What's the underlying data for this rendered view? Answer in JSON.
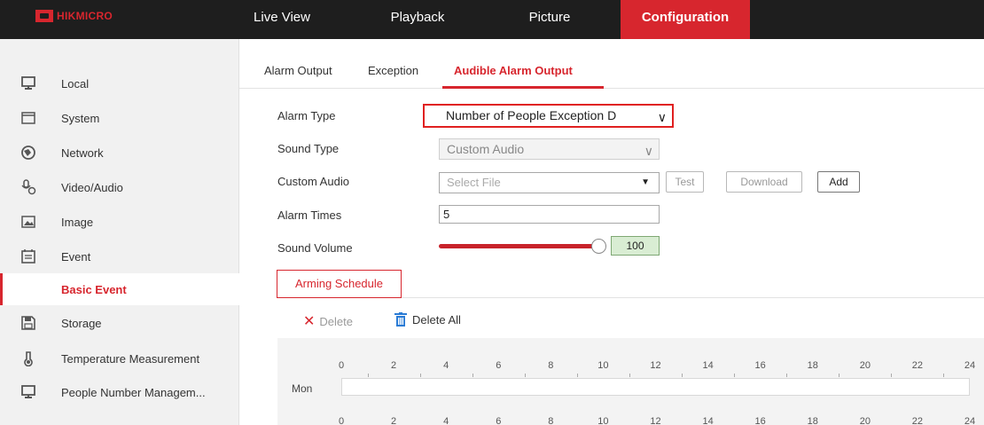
{
  "brand": {
    "name": "HIKMICRO",
    "color": "#d7262e"
  },
  "nav": [
    {
      "label": "Live View"
    },
    {
      "label": "Playback"
    },
    {
      "label": "Picture"
    },
    {
      "label": "Configuration",
      "active": true
    }
  ],
  "sidebar": {
    "items": [
      {
        "label": "Local",
        "icon": "monitor-icon"
      },
      {
        "label": "System",
        "icon": "system-icon"
      },
      {
        "label": "Network",
        "icon": "globe-icon"
      },
      {
        "label": "Video/Audio",
        "icon": "video-audio-icon"
      },
      {
        "label": "Image",
        "icon": "image-icon"
      },
      {
        "label": "Event",
        "icon": "calendar-icon"
      },
      {
        "label": "Basic Event",
        "active": true
      },
      {
        "label": "Storage",
        "icon": "floppy-icon"
      },
      {
        "label": "Temperature Measurement",
        "icon": "thermometer-icon"
      },
      {
        "label": "People Number Managem...",
        "icon": "monitor-icon"
      }
    ]
  },
  "tabs": [
    {
      "label": "Alarm Output"
    },
    {
      "label": "Exception"
    },
    {
      "label": "Audible Alarm Output",
      "active": true
    }
  ],
  "form": {
    "alarm_type": {
      "label": "Alarm Type",
      "value": "Number of People Exception D"
    },
    "sound_type": {
      "label": "Sound Type",
      "value": "Custom Audio"
    },
    "custom_audio": {
      "label": "Custom Audio",
      "placeholder": "Select File",
      "test": "Test",
      "download": "Download",
      "add": "Add"
    },
    "alarm_times": {
      "label": "Alarm Times",
      "value": "5"
    },
    "sound_volume": {
      "label": "Sound Volume",
      "value": "100",
      "level_percent": 100
    }
  },
  "schedule": {
    "tab_label": "Arming Schedule",
    "delete_label": "Delete",
    "delete_all_label": "Delete All",
    "hours": [
      "0",
      "2",
      "4",
      "6",
      "8",
      "10",
      "12",
      "14",
      "16",
      "18",
      "20",
      "22",
      "24"
    ],
    "day": "Mon"
  },
  "colors": {
    "accent": "#d7262e",
    "topbar": "#1e1e1e",
    "sidebar": "#f1f1f1"
  }
}
